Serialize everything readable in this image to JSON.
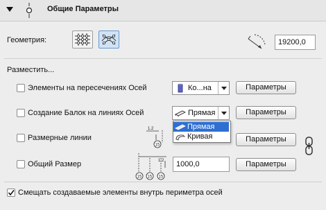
{
  "header": {
    "title": "Общие Параметры"
  },
  "geometry": {
    "label": "Геометрия:",
    "value": "19200,0"
  },
  "place": {
    "label": "Разместить...",
    "rows": [
      {
        "label": "Элементы на пересечениях Осей",
        "dropdown": "Ко...на",
        "button": "Параметры",
        "checked": false
      },
      {
        "label": "Создание Балок на линиях Осей",
        "dropdown": "Прямая",
        "button": "Параметры",
        "checked": false
      },
      {
        "label": "Размерные линии",
        "button": "Параметры",
        "checked": false
      },
      {
        "label": "Общий Размер",
        "field": "1000,0",
        "button": "Параметры",
        "checked": false
      }
    ]
  },
  "dropdown_popup": {
    "options": [
      "Прямая",
      "Кривая"
    ],
    "selected_index": 0
  },
  "dim_icon": {
    "value": "1.2",
    "marker": "15"
  },
  "footer": {
    "label": "Смещать создаваемые элементы внутрь периметра осей",
    "checked": true
  },
  "colors": {
    "accent": "#2e6fd1",
    "toggle_active": "#cfe3f7"
  }
}
